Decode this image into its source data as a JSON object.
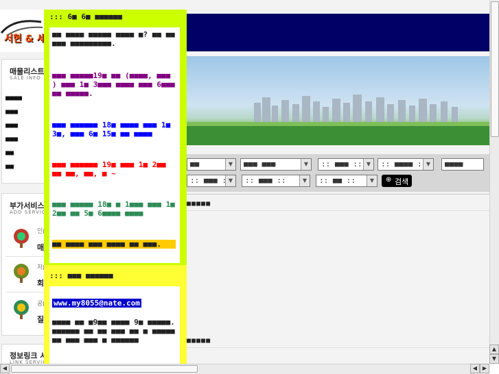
{
  "header": {
    "logo_text": "서현 & 세"
  },
  "sidebar": {
    "listing_box": {
      "title": "매물리스트",
      "subtitle": "SALE INFO",
      "items": [
        "■■■■",
        "■■■",
        "■■■",
        "■■■",
        "■■",
        "■■"
      ]
    },
    "addon_box": {
      "title": "부가서비스",
      "subtitle": "ADD SERVICE",
      "items": [
        "인■■■",
        "저■■■",
        "공■■■"
      ],
      "item_bold": [
        "매",
        "회",
        "질"
      ]
    },
    "links_box": {
      "title": "정보링크 서",
      "subtitle": "LINK SERVICE"
    }
  },
  "search": {
    "row1": [
      "■■",
      "■■■ ■■■",
      ":: ■■■ ::",
      ":: ■■■■ ::",
      "■■■■"
    ],
    "row2": [
      ":: ■■■ ::",
      ":: ■■■ ::",
      ":: ■■ ::"
    ],
    "button_label": "검색"
  },
  "main": {
    "section1_title": "■■■■■",
    "section2_title": "■■■■■",
    "dot": "."
  },
  "popup": {
    "header1": "::: 6■ 6■ ■■■■■■",
    "intro": "■■ ■■■■ ■■■■■ ■■■■ ■? ■■ ■■ ■■■ ■■■■■■■■■.",
    "purple": "■■■ ■■■■■19■ ■■ (■■■■, ■■■ ) ■■■ 1■ 3■■■ ■■■■ ■■■ 6■■■ ■■ ■■■■■.",
    "blue": "■■■ ■■■■■■ 18■ ■■■■ ■■■ 1■ 3■, ■■■ 6■ 15■ ■■ ■■■■",
    "red": "■■■ ■■■■■■ 19■ ■■■ 1■ 2■■ ■■ ■■, ■■, ■ ~",
    "green": "■■■ ■■■■■ 18■ ■ 1■■■ ■■■ 1■ 2■■ ■■ 5■ 6■■■■ ■■■■",
    "highlight": "■■ ■■■■ ■■■ ■■■■ ■■ ■■■.",
    "header2": "::: ■■■ ■■■■■■",
    "email": "www.my8055@nate.com",
    "footer": "■■■■ ■■ ■9■■ ■■■■ 9■ ■■■■■. ■■■■■■ ■■ ■■ ■■■ ■■ ■ ■■■■■ ■■ ■■■ ■■■ ■ ■■■■■■",
    "colors": {
      "purple": "#800080",
      "blue": "#0000ff",
      "red": "#ff0000",
      "green": "#2e8b57",
      "highlight_bg": "#ffcc00",
      "email_bg": "#0000cc",
      "frame": "#ccff00",
      "frame_bottom": "#ffff33"
    }
  },
  "scrollbars": {
    "up": "▲",
    "down": "▼",
    "left": "◀",
    "right": "▶"
  }
}
